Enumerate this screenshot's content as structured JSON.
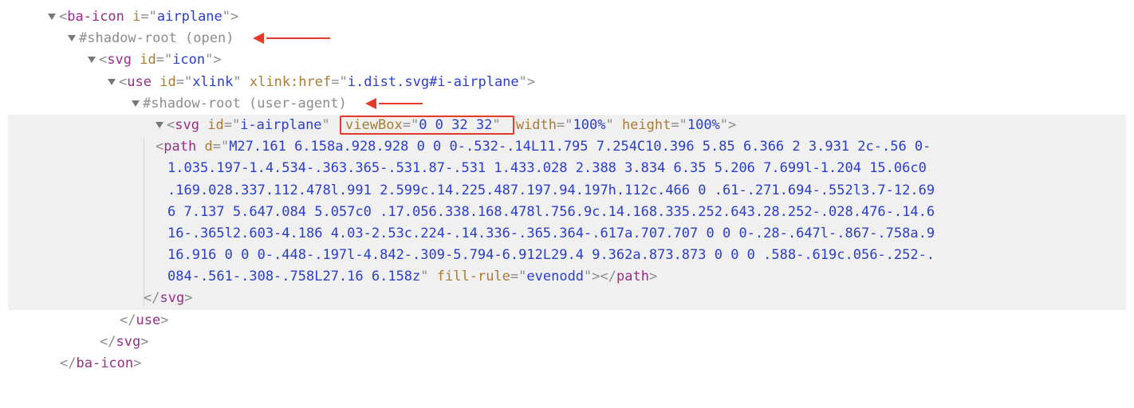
{
  "lines": {
    "baicon_open_tag": "ba-icon",
    "baicon_attr_i": "i",
    "baicon_val_i": "airplane",
    "shadow_root_open": "#shadow-root (open)",
    "svg1_tag": "svg",
    "svg1_attr_id": "id",
    "svg1_val_id": "icon",
    "use_tag": "use",
    "use_attr_id": "id",
    "use_val_id": "xlink",
    "use_attr_href": "xlink:href",
    "use_val_href": "i.dist.svg#i-airplane",
    "shadow_root_ua": "#shadow-root (user-agent)",
    "svg2_tag": "svg",
    "svg2_attr_id": "id",
    "svg2_val_id": "i-airplane",
    "svg2_attr_viewbox": "viewBox",
    "svg2_val_viewbox": "0 0 32 32",
    "svg2_attr_width": "width",
    "svg2_val_width": "100%",
    "svg2_attr_height": "height",
    "svg2_val_height": "100%",
    "path_tag": "path",
    "path_attr_d": "d",
    "path_val_d": "M27.161 6.158a.928.928 0 0 0-.532-.14L11.795 7.254C10.396 5.85 6.366 2 3.931 2c-.56 0-1.035.197-1.4.534-.363.365-.531.87-.531 1.433.028 2.388 3.834 6.35 5.206 7.699l-1.204 15.06c0 .169.028.337.112.478l.991 2.599c.14.225.487.197.94.197h.112c.466 0 .61-.271.694-.552l3.7-12.696 7.137 5.647.084 5.057c0 .17.056.338.168.478l.756.9c.14.168.335.252.643.28.252-.028.476-.14.616-.365l2.603-4.186 4.03-2.53c.224-.14.336-.365.364-.617a.707.707 0 0 0-.28-.647l-.867-.758a.916.916 0 0 0-.448-.197l-4.842-.309-5.794-6.912L29.4 9.362a.873.873 0 0 0 .588-.619c.056-.252-.084-.561-.308-.758L27.16 6.158z",
    "path_attr_fill": "fill-rule",
    "path_val_fill": "evenodd",
    "close_path": "path",
    "close_svg2": "svg",
    "close_use": "use",
    "close_svg1": "svg",
    "close_baicon": "ba-icon"
  }
}
